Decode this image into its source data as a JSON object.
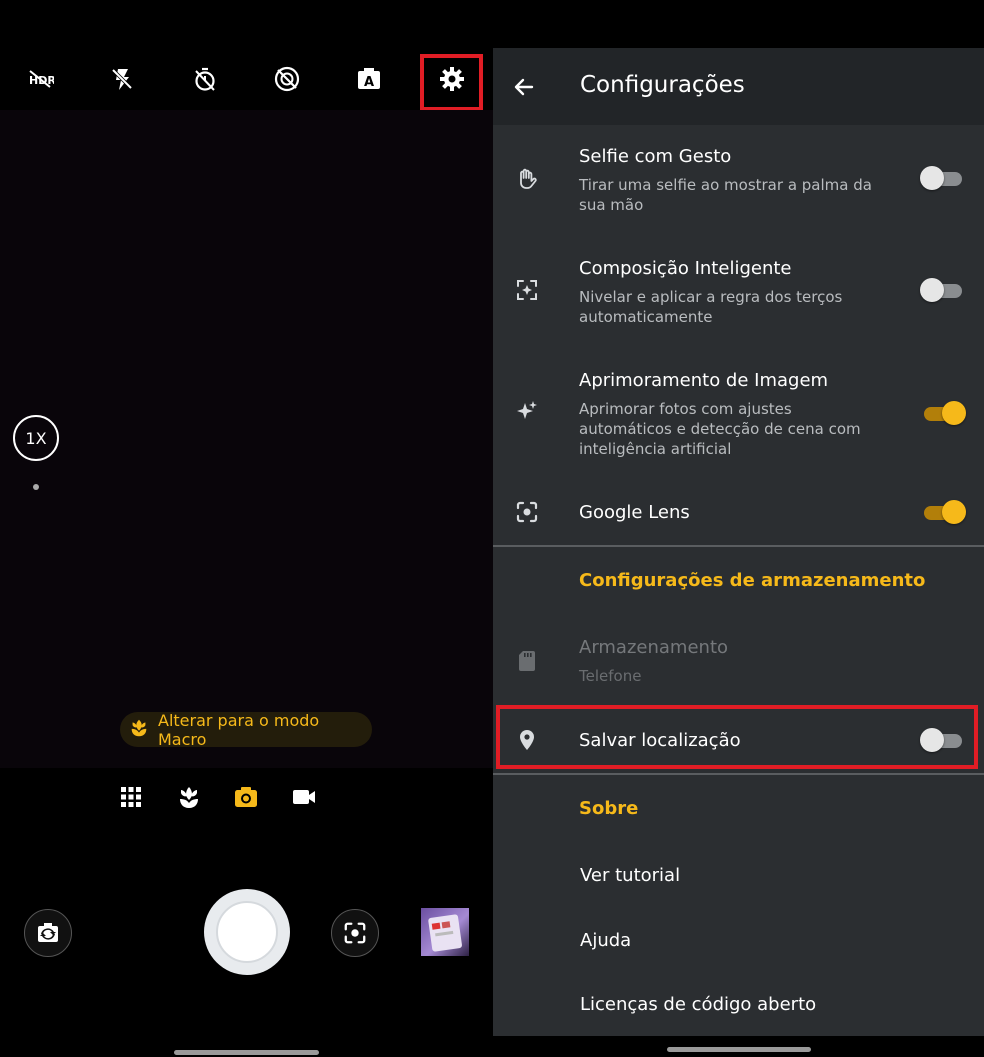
{
  "camera": {
    "toolbar": {
      "icons": [
        "hdr-off-icon",
        "flash-off-icon",
        "timer-off-icon",
        "motion-off-icon",
        "auto-mode-icon",
        "gear-icon"
      ]
    },
    "zoom_label": "1X",
    "macro_chip_label": "Alterar para o modo Macro",
    "modes": [
      "grid-icon",
      "macro-icon",
      "photo-icon",
      "video-icon"
    ],
    "active_mode": "photo-icon"
  },
  "settings": {
    "title": "Configurações",
    "items": [
      {
        "title": "Selfie com Gesto",
        "subtitle": "Tirar uma selfie ao mostrar a palma da sua mão",
        "icon": "hand-icon",
        "enabled": false
      },
      {
        "title": "Composição Inteligente",
        "subtitle": "Nivelar e aplicar a regra dos terços automaticamente",
        "icon": "composition-icon",
        "enabled": false
      },
      {
        "title": "Aprimoramento de Imagem",
        "subtitle": "Aprimorar fotos com ajustes automáticos e detecção de cena com inteligência artificial",
        "icon": "sparkle-icon",
        "enabled": true
      },
      {
        "title": "Google Lens",
        "icon": "lens-icon",
        "enabled": true
      }
    ],
    "storage_section": {
      "title": "Configurações de armazenamento",
      "storage_title": "Armazenamento",
      "storage_value": "Telefone",
      "location_title": "Salvar localização",
      "location_enabled": false
    },
    "about_section": {
      "title": "Sobre",
      "items": [
        "Ver tutorial",
        "Ajuda",
        "Licenças de código aberto"
      ]
    }
  },
  "colors": {
    "accent": "#f6b91a",
    "highlight": "#e11d25",
    "panel": "#2b2e31",
    "header": "#222528"
  }
}
